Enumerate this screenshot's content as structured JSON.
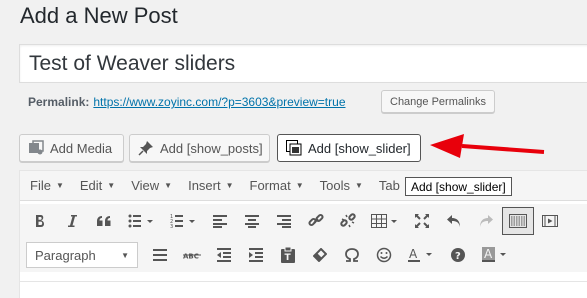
{
  "page": {
    "title": "Add a New Post"
  },
  "post": {
    "title_value": "Test of Weaver sliders"
  },
  "permalink": {
    "label": "Permalink:",
    "url": "https://www.zoyinc.com/?p=3603&preview=true",
    "change_button": "Change Permalinks"
  },
  "media_buttons": {
    "add_media": "Add Media",
    "add_show_posts": "Add [show_posts]",
    "add_show_slider": "Add [show_slider]"
  },
  "menubar": {
    "file": "File",
    "edit": "Edit",
    "view": "View",
    "insert": "Insert",
    "format": "Format",
    "tools": "Tools",
    "table": "Tab"
  },
  "toolbar": {
    "format_select": "Paragraph"
  },
  "tooltip": {
    "text": "Add [show_slider]"
  },
  "colors": {
    "accent": "#0073aa",
    "arrow": "#e8000b"
  }
}
